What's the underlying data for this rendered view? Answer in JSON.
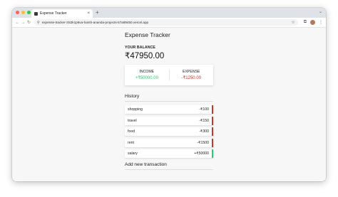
{
  "browser": {
    "tab_title": "Expense Tracker",
    "url": "expense-tracker-3S2k1p6va-harsh-ananda-projects-57a89450.vercel.app",
    "new_tab_label": "+",
    "tab_close": "×",
    "back": "←",
    "forward": "→",
    "reload": "↻",
    "tune": "⚲",
    "star": "☆",
    "extensions": "⧉",
    "menu": "⋮",
    "chevron": "⌄"
  },
  "app": {
    "title": "Expense Tracker",
    "balance_label": "YOUR BALANCE",
    "balance_value": "₹47950.00",
    "income_label": "INCOME",
    "income_value": "+₹50000.00",
    "expense_label": "EXPENSE",
    "expense_value": "-₹1250.00",
    "history_title": "History",
    "add_title": "Add new transaction",
    "transactions": [
      {
        "text": "shopping",
        "amount": "-₹100"
      },
      {
        "text": "travel",
        "amount": "-₹150"
      },
      {
        "text": "food",
        "amount": "-₹300"
      },
      {
        "text": "rent",
        "amount": "-₹1500"
      },
      {
        "text": "salary",
        "amount": "+₹50000"
      }
    ]
  },
  "colors": {
    "income": "#2ecc71",
    "expense": "#c0392b"
  }
}
